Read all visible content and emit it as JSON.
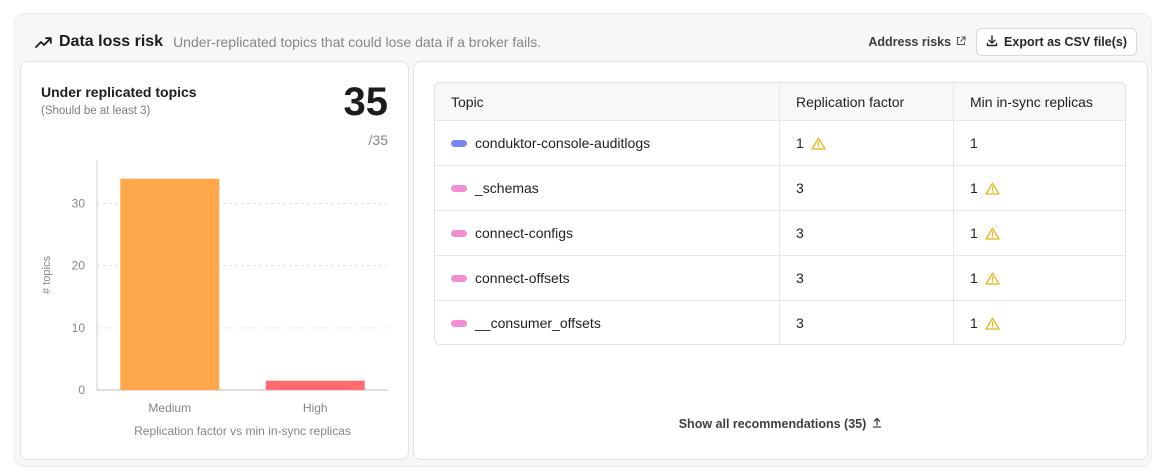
{
  "header": {
    "title": "Data loss risk",
    "subtitle": "Under-replicated topics that could lose data if a broker fails.",
    "address_risks": "Address risks",
    "export_csv": "Export as CSV file(s)"
  },
  "summary": {
    "title": "Under replicated topics",
    "subtitle": "(Should be at least 3)",
    "count": "35",
    "total": "/35"
  },
  "chart_data": {
    "type": "bar",
    "categories": [
      "Medium",
      "High"
    ],
    "values": [
      34,
      1.5
    ],
    "colors": [
      "#ffa74a",
      "#ff6b6f"
    ],
    "xlabel": "Replication factor vs min in-sync replicas",
    "ylabel": "# topics",
    "ylim": [
      0,
      37
    ],
    "yticks": [
      0,
      10,
      20,
      30
    ],
    "grid": true
  },
  "table": {
    "columns": [
      "Topic",
      "Replication factor",
      "Min in-sync replicas"
    ],
    "rows": [
      {
        "topic": "conduktor-console-auditlogs",
        "color": "#7a86f0",
        "replication": "1",
        "rep_warn": true,
        "min_isr": "1",
        "isr_warn": false
      },
      {
        "topic": "_schemas",
        "color": "#f28fd4",
        "replication": "3",
        "rep_warn": false,
        "min_isr": "1",
        "isr_warn": true
      },
      {
        "topic": "connect-configs",
        "color": "#f28fd4",
        "replication": "3",
        "rep_warn": false,
        "min_isr": "1",
        "isr_warn": true
      },
      {
        "topic": "connect-offsets",
        "color": "#f28fd4",
        "replication": "3",
        "rep_warn": false,
        "min_isr": "1",
        "isr_warn": true
      },
      {
        "topic": "__consumer_offsets",
        "color": "#f28fd4",
        "replication": "3",
        "rep_warn": false,
        "min_isr": "1",
        "isr_warn": true
      }
    ]
  },
  "footer": {
    "show_all": "Show all recommendations (35)"
  }
}
